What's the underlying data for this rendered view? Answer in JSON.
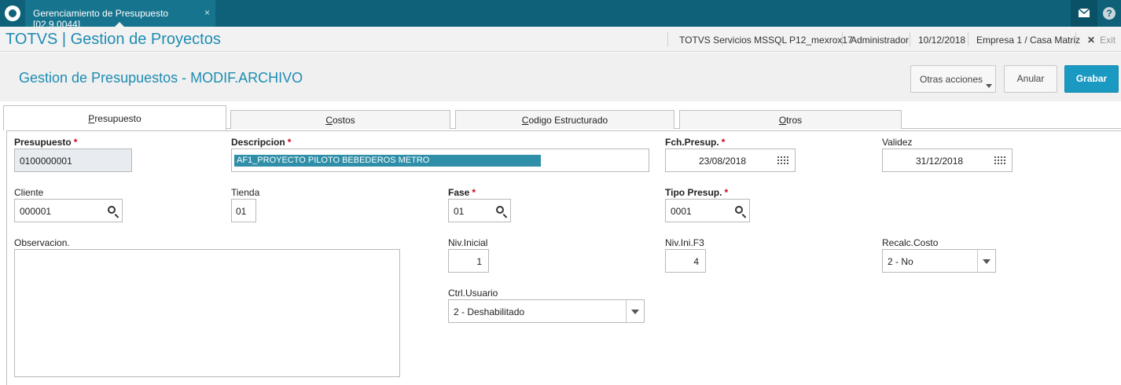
{
  "topbar": {
    "tab_title": "Gerenciamiento de Presupuesto [02.9.0044]",
    "tab_close": "×",
    "help": "?"
  },
  "header": {
    "app_title": "TOTVS | Gestion de Proyectos",
    "environment": "TOTVS Servicios MSSQL P12_mexrox17",
    "user": "Administrador",
    "date": "10/12/2018",
    "company": "Empresa 1 / Casa Matriz",
    "exit_label": "Exit"
  },
  "page": {
    "title": "Gestion de Presupuestos - MODIF.ARCHIVO",
    "btn_otras": "Otras acciones",
    "btn_anular": "Anular",
    "btn_grabar": "Grabar"
  },
  "tabs": [
    {
      "label": "Presupuesto",
      "active": true
    },
    {
      "label": "Costos",
      "active": false
    },
    {
      "label": "Codigo Estructurado",
      "active": false
    },
    {
      "label": "Otros",
      "active": false
    }
  ],
  "form": {
    "presupuesto": {
      "label": "Presupuesto",
      "value": "0100000001"
    },
    "descripcion": {
      "label": "Descripcion",
      "value": "AF1_PROYECTO PILOTO BEBEDEROS METRO"
    },
    "fch_presup": {
      "label": "Fch.Presup.",
      "value": "23/08/2018"
    },
    "validez": {
      "label": "Validez",
      "value": "31/12/2018"
    },
    "cliente": {
      "label": "Cliente",
      "value": "000001"
    },
    "tienda": {
      "label": "Tienda",
      "value": "01"
    },
    "fase": {
      "label": "Fase",
      "value": "01"
    },
    "tipo_presup": {
      "label": "Tipo Presup.",
      "value": "0001"
    },
    "observacion": {
      "label": "Observacion.",
      "value": ""
    },
    "niv_inicial": {
      "label": "Niv.Inicial",
      "value": "1"
    },
    "niv_ini_f3": {
      "label": "Niv.Ini.F3",
      "value": "4"
    },
    "recalc_costo": {
      "label": "Recalc.Costo",
      "value": "2 - No"
    },
    "ctrl_usuario": {
      "label": "Ctrl.Usuario",
      "value": "2 - Deshabilitado"
    },
    "required_mark": "*"
  },
  "colors": {
    "accent": "#1e8cb2",
    "topbar": "#0e6178",
    "primary_button": "#1a9ac2",
    "required": "#d0021b"
  }
}
